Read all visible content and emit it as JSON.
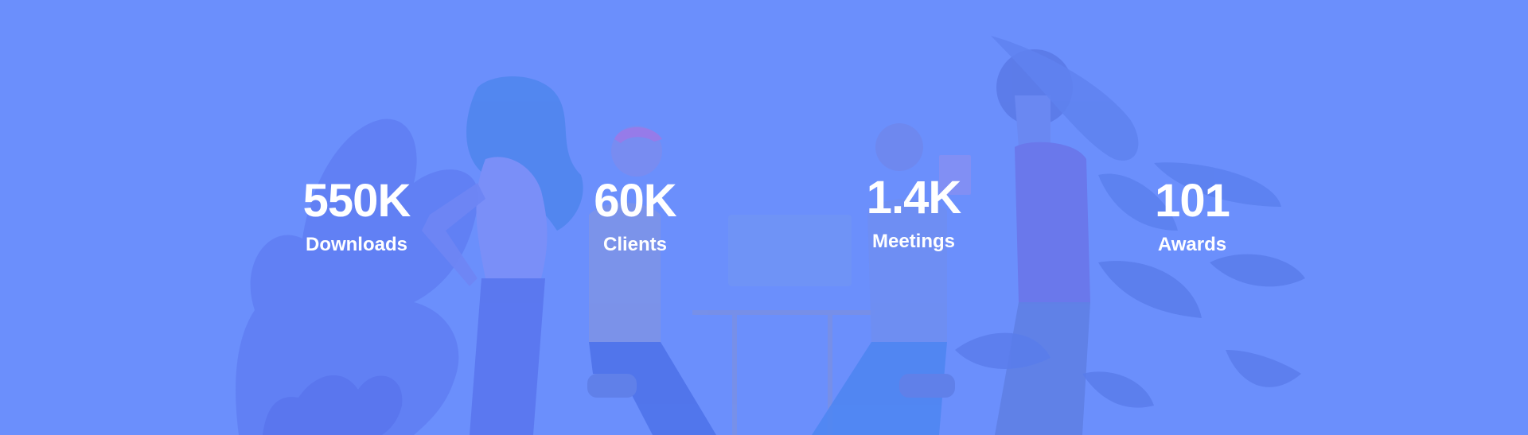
{
  "colors": {
    "background": "#6b8ffc",
    "text": "#ffffff"
  },
  "stats": [
    {
      "value": "550K",
      "label": "Downloads"
    },
    {
      "value": "60K",
      "label": "Clients"
    },
    {
      "value": "1.4K",
      "label": "Meetings"
    },
    {
      "value": "101",
      "label": "Awards"
    }
  ],
  "background_illustration": "office-team-working-illustration"
}
